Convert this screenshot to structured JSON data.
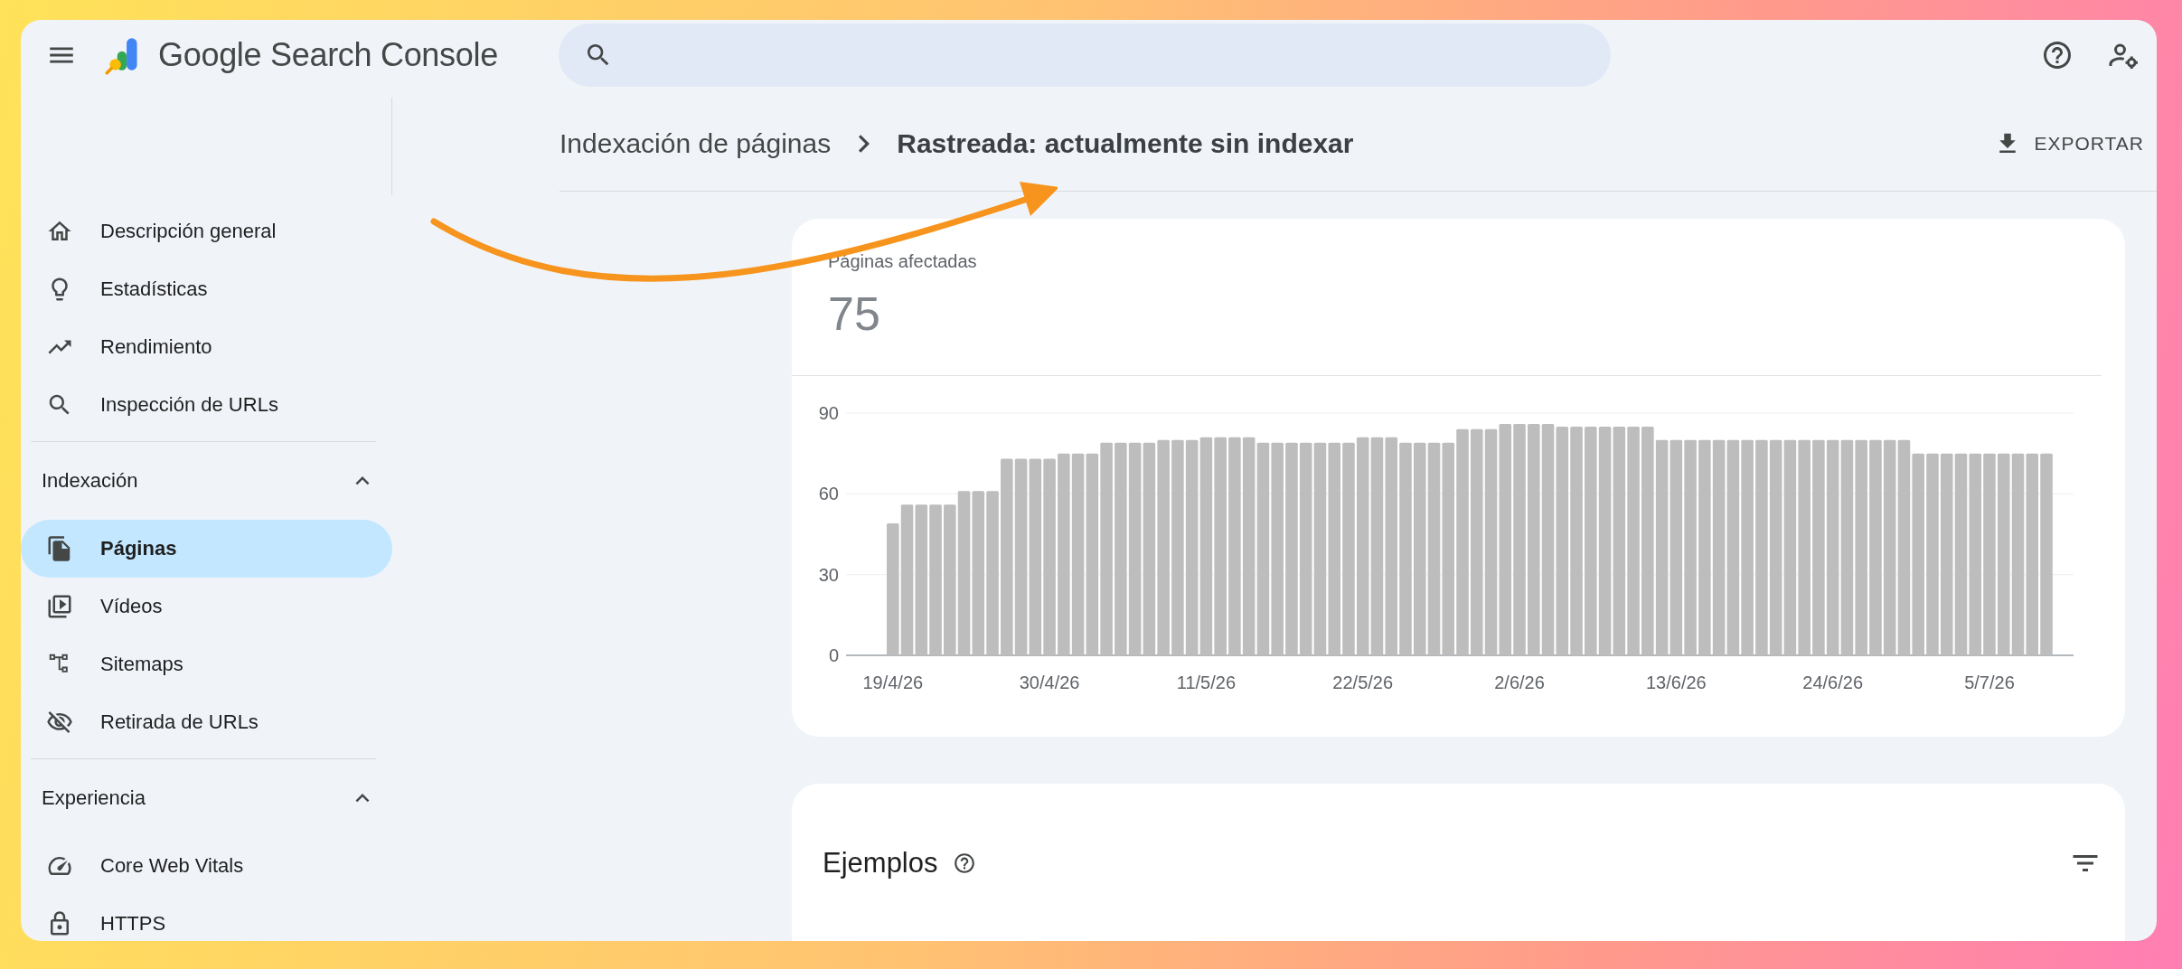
{
  "header": {
    "app_name": "Google Search Console"
  },
  "breadcrumb": [
    "Indexación de páginas",
    "Rastreada: actualmente sin indexar"
  ],
  "export_button": "EXPORTAR",
  "sidebar": {
    "items": [
      {
        "label": "Descripción general",
        "selected": false
      },
      {
        "label": "Estadísticas",
        "selected": false
      },
      {
        "label": "Rendimiento",
        "selected": false
      },
      {
        "label": "Inspección de URLs",
        "selected": false
      }
    ],
    "sections": [
      {
        "title": "Indexación",
        "expanded": true,
        "items": [
          {
            "label": "Páginas",
            "selected": true
          },
          {
            "label": "Vídeos",
            "selected": false
          },
          {
            "label": "Sitemaps",
            "selected": false
          },
          {
            "label": "Retirada de URLs",
            "selected": false
          }
        ]
      },
      {
        "title": "Experiencia",
        "expanded": true,
        "items": [
          {
            "label": "Core Web Vitals",
            "selected": false
          },
          {
            "label": "HTTPS",
            "selected": false
          }
        ]
      }
    ]
  },
  "summary": {
    "label": "Páginas afectadas",
    "value": "75",
    "chart_data": {
      "type": "bar",
      "ylim": [
        0,
        90
      ],
      "yticks": [
        0,
        30,
        60,
        90
      ],
      "categories": [
        "19/4/26",
        null,
        null,
        null,
        null,
        null,
        null,
        null,
        null,
        null,
        null,
        "30/4/26",
        null,
        null,
        null,
        null,
        null,
        null,
        null,
        null,
        null,
        null,
        "11/5/26",
        null,
        null,
        null,
        null,
        null,
        null,
        null,
        null,
        null,
        null,
        "22/5/26",
        null,
        null,
        null,
        null,
        null,
        null,
        null,
        null,
        null,
        null,
        "2/6/26",
        null,
        null,
        null,
        null,
        null,
        null,
        null,
        null,
        null,
        null,
        "13/6/26",
        null,
        null,
        null,
        null,
        null,
        null,
        null,
        null,
        null,
        null,
        "24/6/26",
        null,
        null,
        null,
        null,
        null,
        null,
        null,
        null,
        null,
        null,
        "5/7/26",
        null,
        null,
        null,
        null
      ],
      "values": [
        49,
        56,
        56,
        56,
        56,
        61,
        61,
        61,
        73,
        73,
        73,
        73,
        75,
        75,
        75,
        79,
        79,
        79,
        79,
        80,
        80,
        80,
        81,
        81,
        81,
        81,
        79,
        79,
        79,
        79,
        79,
        79,
        79,
        81,
        81,
        81,
        79,
        79,
        79,
        79,
        84,
        84,
        84,
        86,
        86,
        86,
        86,
        85,
        85,
        85,
        85,
        85,
        85,
        85,
        80,
        80,
        80,
        80,
        80,
        80,
        80,
        80,
        80,
        80,
        80,
        80,
        80,
        80,
        80,
        80,
        80,
        80,
        75,
        75,
        75,
        75,
        75,
        75,
        75,
        75,
        75,
        75
      ]
    }
  },
  "examples": {
    "title": "Ejemplos"
  }
}
